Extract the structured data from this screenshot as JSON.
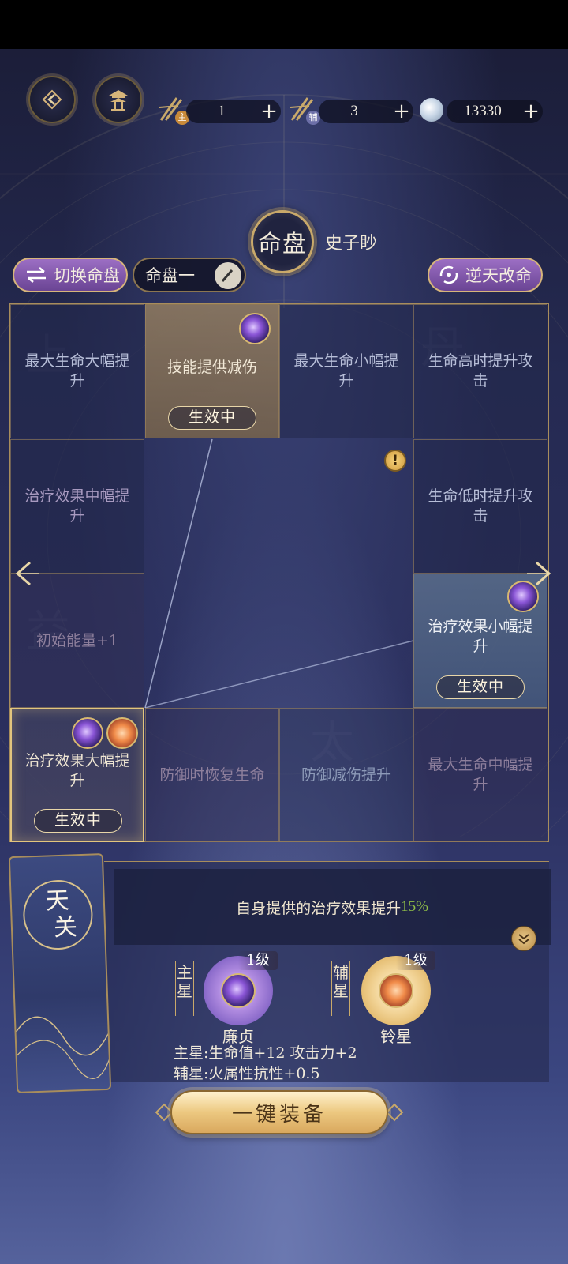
{
  "header": {
    "resources": [
      {
        "name": "main-star-token",
        "icon": "brush-icon",
        "badge": "主",
        "badge_color": "#c98a3a",
        "value": "1"
      },
      {
        "name": "aux-star-token",
        "icon": "brush-icon",
        "badge": "辅",
        "badge_color": "#6c6fa8",
        "value": "3"
      },
      {
        "name": "currency",
        "icon": "silver-orb-icon",
        "value": "13330"
      }
    ],
    "plus": "+"
  },
  "title": {
    "emblem": "命盘",
    "character": "史子眇"
  },
  "controls": {
    "switch_label": "切换命盘",
    "chart_name": "命盘一",
    "reroll_label": "逆天改命"
  },
  "grid": {
    "effect_label": "生效中",
    "cells": [
      {
        "text": "最大生命大幅提升"
      },
      {
        "text": "技能提供减伤"
      },
      {
        "text": "最大生命小幅提升"
      },
      {
        "text": "生命高时提升攻击"
      },
      {
        "text": "治疗效果中幅提升"
      },
      {
        "text": "生命低时提升攻击"
      },
      {
        "text": "初始能量+1"
      },
      {
        "text": "治疗效果小幅提升"
      },
      {
        "text": "治疗效果大幅提升"
      },
      {
        "text": "防御时恢复生命"
      },
      {
        "text": "防御减伤提升"
      },
      {
        "text": "最大生命中幅提升"
      }
    ]
  },
  "panel": {
    "palace": [
      "天",
      "关"
    ],
    "description_prefix": "自身提供的治疗效果提升",
    "description_value": "15%",
    "main_star": {
      "tag": "主星",
      "name": "廉贞",
      "level": "1级"
    },
    "aux_star": {
      "tag": "辅星",
      "name": "铃星",
      "level": "1级"
    },
    "stat_main": "主星:生命值+12 攻击力+2",
    "stat_aux": "辅星:火属性抗性+0.5"
  },
  "equip_label": "一键装备",
  "colors": {
    "gold": "#c9a96a",
    "highlight_green": "#8fbe48",
    "bg_navy": "#252a52"
  }
}
